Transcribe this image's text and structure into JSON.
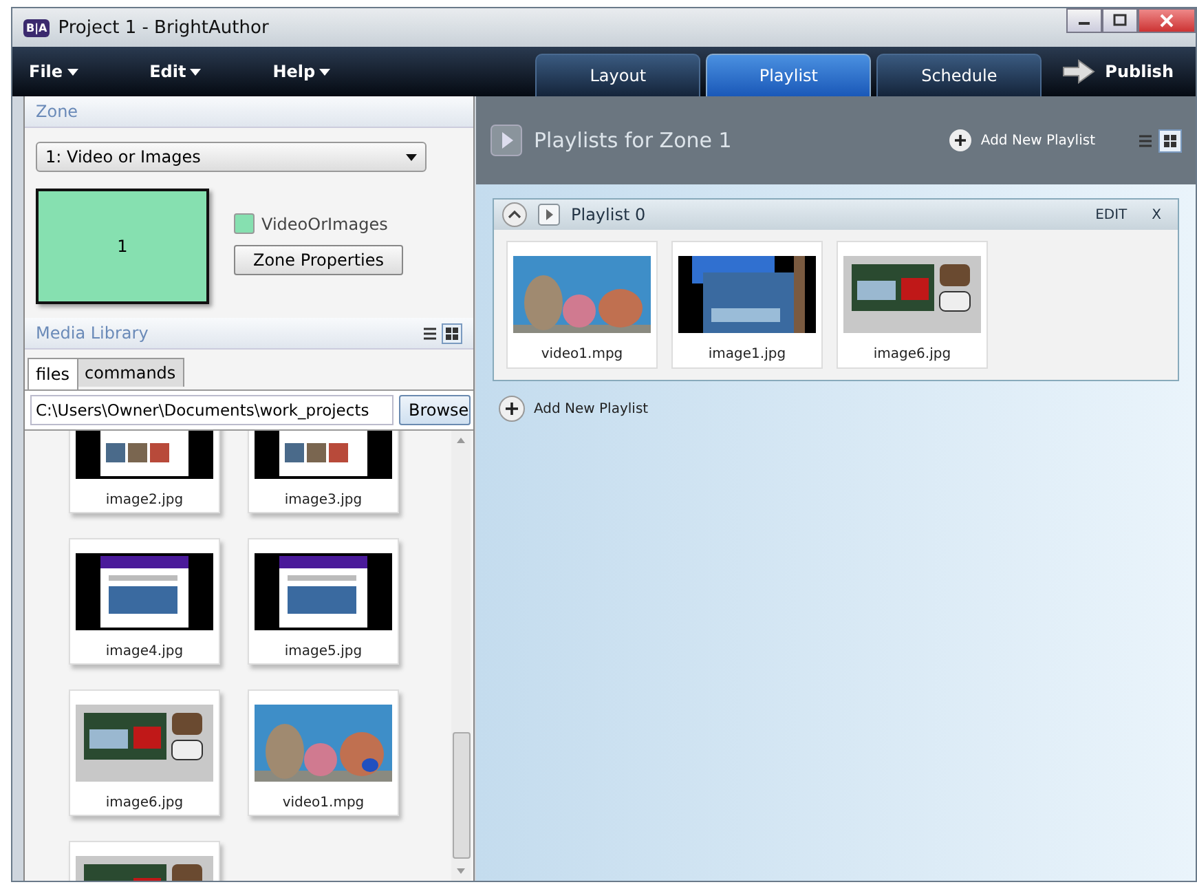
{
  "window": {
    "title": "Project 1 - BrightAuthor",
    "logo": "B|A"
  },
  "menu": [
    "File",
    "Edit",
    "Help"
  ],
  "tabs": [
    {
      "label": "Layout",
      "selected": false
    },
    {
      "label": "Playlist",
      "selected": true
    },
    {
      "label": "Schedule",
      "selected": false
    }
  ],
  "publish": "Publish",
  "zone": {
    "header": "Zone",
    "dropdown": "1: Video or Images",
    "preview_label": "1",
    "legend": "VideoOrImages",
    "properties_button": "Zone Properties"
  },
  "media_library": {
    "header": "Media Library",
    "view_grid_selected": true,
    "tabs": [
      {
        "label": "files",
        "selected": true
      },
      {
        "label": "commands",
        "selected": false
      }
    ],
    "path": "C:\\Users\\Owner\\Documents\\work_projects",
    "browse": "Browse",
    "items": [
      {
        "kind": "file",
        "name": "image2.jpg"
      },
      {
        "kind": "file",
        "name": "image3.jpg"
      },
      {
        "kind": "file",
        "name": "image4.jpg"
      },
      {
        "kind": "file",
        "name": "image5.jpg"
      },
      {
        "kind": "file",
        "name": "image6.jpg"
      },
      {
        "kind": "file",
        "name": "video1.mpg"
      },
      {
        "kind": "picture"
      }
    ]
  },
  "playlists_panel": {
    "title": "Playlists for Zone 1",
    "add_top": "Add New Playlist",
    "view_grid_selected": true,
    "playlists": [
      {
        "name": "Playlist 0",
        "expanded": true,
        "edit": "EDIT",
        "close": "X",
        "items": [
          "video1.mpg",
          "image1.jpg",
          "image6.jpg"
        ]
      }
    ],
    "add_bottom": "Add New Playlist"
  }
}
